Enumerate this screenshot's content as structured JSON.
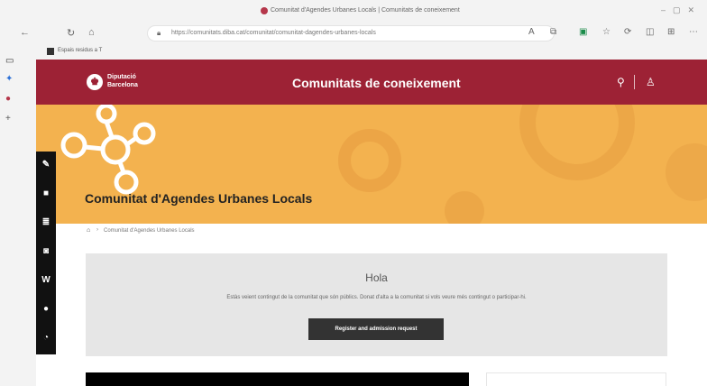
{
  "browser": {
    "tab_title": "Comunitat d'Agendes Urbanes Locals | Comunitats de coneixement",
    "url": "https://comunitats.diba.cat/comunitat/comunitat-dagendes-urbanes-locals",
    "favorites_bar": {
      "item_label": "Espais residus a T"
    }
  },
  "site": {
    "logo_line1": "Diputació",
    "logo_line2": "Barcelona",
    "title": "Comunitats de coneixement",
    "search_icon_glyph": "⚲",
    "user_icon_glyph": "♙"
  },
  "page": {
    "title": "Comunitat d'Agendes Urbanes Locals",
    "breadcrumb": {
      "home_glyph": "⌂",
      "separator": "›",
      "current": "Comunitat d'Agendes Urbanes Locals"
    }
  },
  "social_icons": [
    {
      "name": "edit-icon",
      "glyph": "✎"
    },
    {
      "name": "document-icon",
      "glyph": "■"
    },
    {
      "name": "list-icon",
      "glyph": "≣"
    },
    {
      "name": "camera-icon",
      "glyph": "◙"
    },
    {
      "name": "wikipedia-icon",
      "glyph": "W"
    },
    {
      "name": "chat-icon",
      "glyph": "●"
    },
    {
      "name": "rss-icon",
      "glyph": "◔"
    }
  ],
  "hola_box": {
    "heading": "Hola",
    "text": "Estàs veient contingut de la comunitat que són públics. Donat d'alta a la comunitat si vols veure més contingut o participar-hi.",
    "button_label": "Register and admission request"
  },
  "colors": {
    "header": "#9d2235",
    "banner": "#f3b24f",
    "title_band": "#fdf3e8",
    "hola_box": "#e6e6e6",
    "button": "#333333"
  }
}
